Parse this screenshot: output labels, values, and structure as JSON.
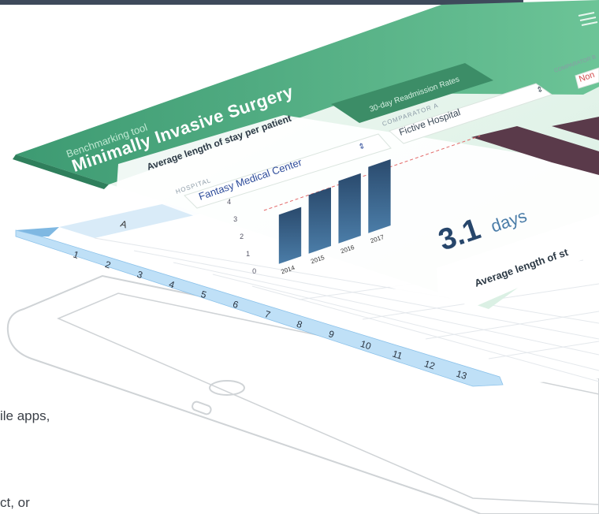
{
  "screen": {
    "menu_icon": "hamburger-icon",
    "subtitle": "Benchmarking tool",
    "title": "Minimally Invasive Surgery",
    "tab_right": "30-day Readmission Rates",
    "card_title": "Average length of stay per patient",
    "hospital_label": "HOSPITAL",
    "hospital_value": "Fantasy Medical Center",
    "comparator_a_label": "COMPARATOR A",
    "comparator_a_value": "Fictive Hospital",
    "comparator_b_label": "COMPARATOR B",
    "comparator_b_value": "Non",
    "big_value": "3.1",
    "big_unit": "days",
    "bottom_card_title": "Average length of st",
    "select_icon": "up-down-arrows-icon"
  },
  "chart_data": [
    {
      "type": "bar",
      "title": "Average length of stay per patient",
      "categories": [
        "2014",
        "2015",
        "2016",
        "2017"
      ],
      "values": [
        2.6,
        3.1,
        3.3,
        3.5
      ],
      "ylim": [
        0,
        4
      ],
      "yticks": [
        "0",
        "1",
        "2",
        "3",
        "4"
      ],
      "reference_line": 3.1,
      "colors": {
        "bar_top": "#2a4a6d",
        "bar_bottom": "#4b7da8",
        "reference": "#e36a6a"
      }
    }
  ],
  "spreadsheet": {
    "column_header": "A",
    "row_numbers": [
      "1",
      "2",
      "3",
      "4",
      "5",
      "6",
      "7",
      "8",
      "9",
      "10",
      "11",
      "12",
      "13"
    ]
  },
  "copy": {
    "line1": "ile apps,",
    "line2": "ct, or"
  },
  "colors": {
    "brand_green": "#4aa57c",
    "topbar": "#3e4a5b",
    "row_blue": "#bfe0f7",
    "device_outline": "#cfd3d6"
  }
}
